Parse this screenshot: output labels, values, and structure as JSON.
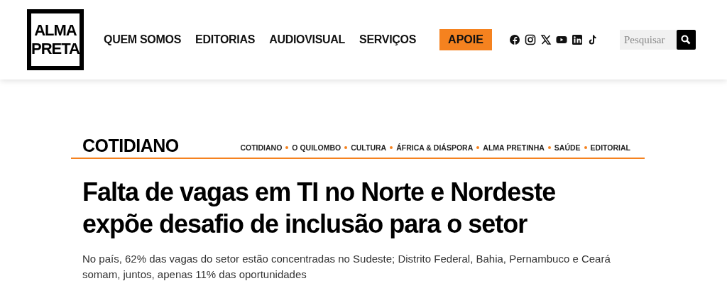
{
  "header": {
    "logo": [
      "ALMA",
      "PRETA"
    ],
    "nav": [
      "QUEM SOMOS",
      "EDITORIAS",
      "AUDIOVISUAL",
      "SERVIÇOS"
    ],
    "cta": "APOIE",
    "search": {
      "placeholder": "Pesquisar"
    }
  },
  "section": {
    "title": "COTIDIANO",
    "links": [
      "COTIDIANO",
      "O QUILOMBO",
      "CULTURA",
      "ÁFRICA & DIÁSPORA",
      "ALMA PRETINHA",
      "SAÚDE",
      "EDITORIAL"
    ]
  },
  "article": {
    "headline": "Falta de vagas em TI no Norte e Nordeste expõe desafio de inclusão para o setor",
    "subtitle": "No país, 62% das vagas do setor estão concentradas no Sudeste; Distrito Federal, Bahia, Pernambuco e Ceará somam, juntos, apenas 11% das oportunidades"
  }
}
